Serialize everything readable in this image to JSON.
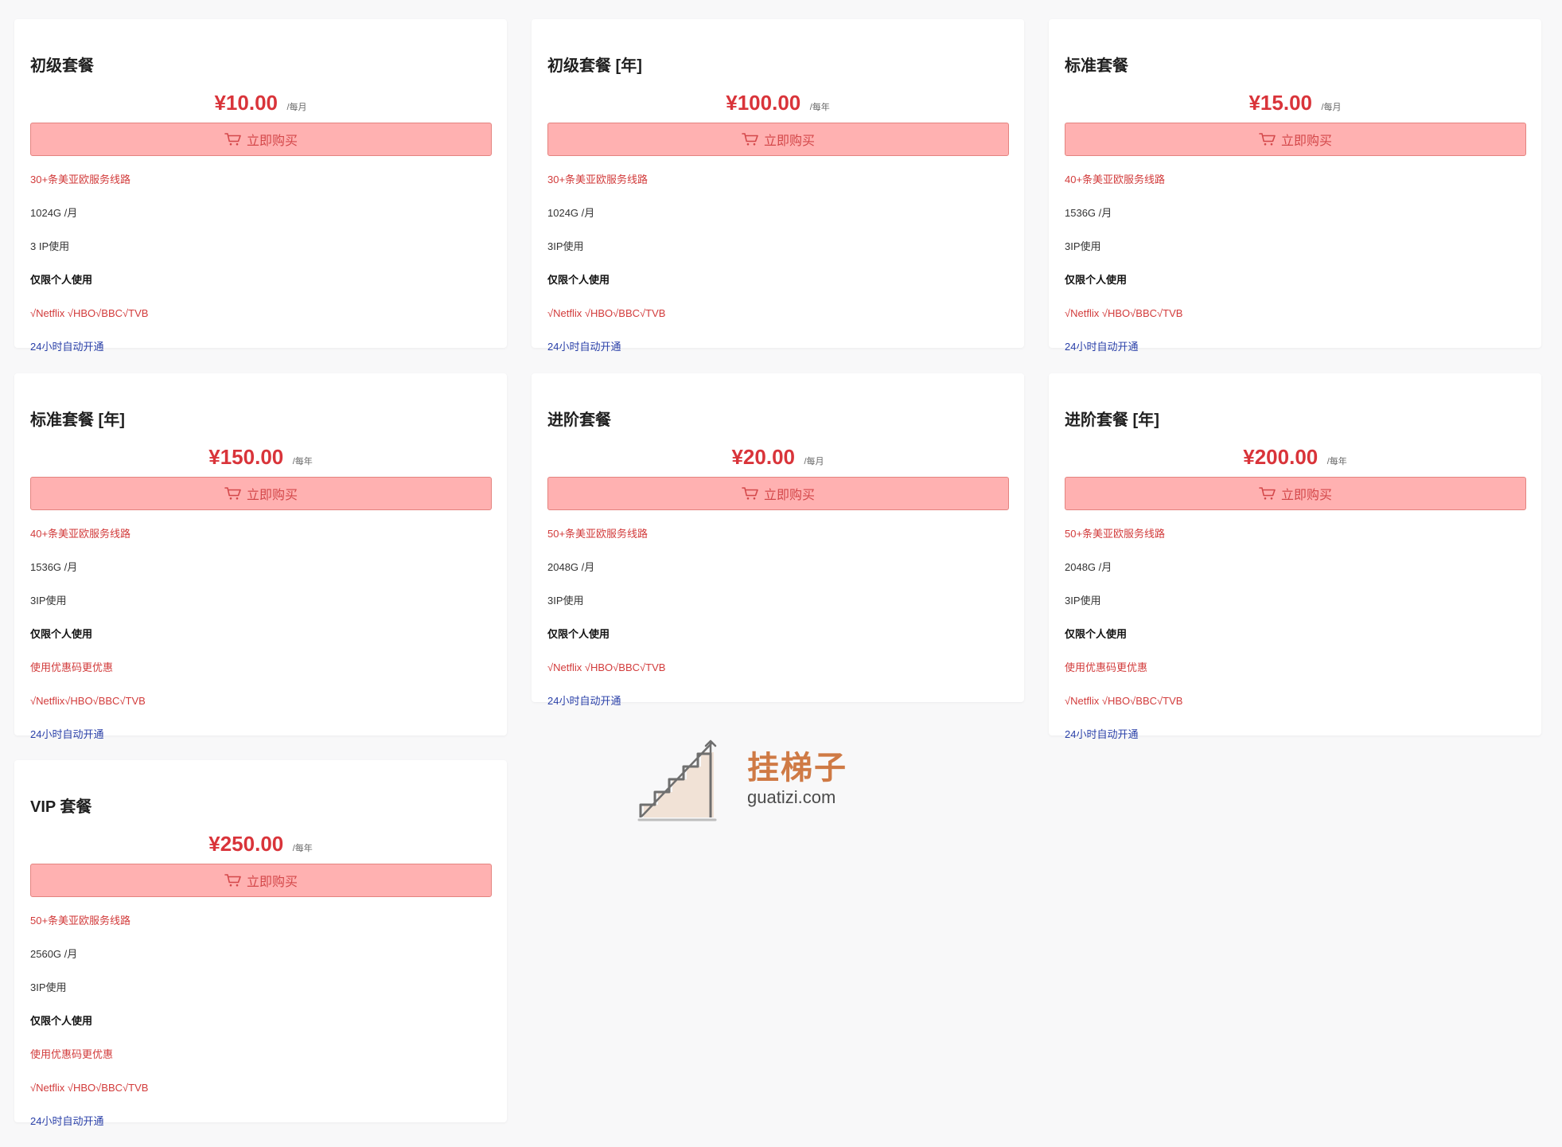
{
  "plans": [
    {
      "title": "初级套餐",
      "price": "¥10.00",
      "period": "/每月",
      "button_label": "立即购买",
      "features": [
        {
          "text": "30+条美亚欧服务线路",
          "style": "red"
        },
        {
          "text": "1024G /月",
          "style": "dark"
        },
        {
          "text": "3 IP使用",
          "style": "dark"
        },
        {
          "text": "仅限个人使用",
          "style": "bold"
        },
        {
          "text": "√Netflix √HBO√BBC√TVB",
          "style": "red"
        },
        {
          "text": "24小时自动开通",
          "style": "blue"
        }
      ]
    },
    {
      "title": "初级套餐 [年]",
      "price": "¥100.00",
      "period": "/每年",
      "button_label": "立即购买",
      "features": [
        {
          "text": "30+条美亚欧服务线路",
          "style": "red"
        },
        {
          "text": "1024G /月",
          "style": "dark"
        },
        {
          "text": "3IP使用",
          "style": "dark"
        },
        {
          "text": "仅限个人使用",
          "style": "bold"
        },
        {
          "text": "√Netflix √HBO√BBC√TVB",
          "style": "red"
        },
        {
          "text": "24小时自动开通",
          "style": "blue"
        }
      ]
    },
    {
      "title": "标准套餐",
      "price": "¥15.00",
      "period": "/每月",
      "button_label": "立即购买",
      "features": [
        {
          "text": "40+条美亚欧服务线路",
          "style": "red"
        },
        {
          "text": "1536G /月",
          "style": "dark"
        },
        {
          "text": "3IP使用",
          "style": "dark"
        },
        {
          "text": "仅限个人使用",
          "style": "bold"
        },
        {
          "text": "√Netflix √HBO√BBC√TVB",
          "style": "red"
        },
        {
          "text": "24小时自动开通",
          "style": "blue"
        }
      ]
    },
    {
      "title": "标准套餐 [年]",
      "price": "¥150.00",
      "period": "/每年",
      "button_label": "立即购买",
      "features": [
        {
          "text": "40+条美亚欧服务线路",
          "style": "red"
        },
        {
          "text": "1536G /月",
          "style": "dark"
        },
        {
          "text": "3IP使用",
          "style": "dark"
        },
        {
          "text": "仅限个人使用",
          "style": "bold"
        },
        {
          "text": "使用优惠码更优惠",
          "style": "red"
        },
        {
          "text": "√Netflix√HBO√BBC√TVB",
          "style": "red"
        },
        {
          "text": "24小时自动开通",
          "style": "blue"
        }
      ]
    },
    {
      "title": "进阶套餐",
      "price": "¥20.00",
      "period": "/每月",
      "button_label": "立即购买",
      "features": [
        {
          "text": "50+条美亚欧服务线路",
          "style": "red"
        },
        {
          "text": "2048G /月",
          "style": "dark"
        },
        {
          "text": "3IP使用",
          "style": "dark"
        },
        {
          "text": "仅限个人使用",
          "style": "bold"
        },
        {
          "text": "√Netflix √HBO√BBC√TVB",
          "style": "red"
        },
        {
          "text": "24小时自动开通",
          "style": "blue"
        }
      ]
    },
    {
      "title": "进阶套餐 [年]",
      "price": "¥200.00",
      "period": "/每年",
      "button_label": "立即购买",
      "features": [
        {
          "text": "50+条美亚欧服务线路",
          "style": "red"
        },
        {
          "text": "2048G /月",
          "style": "dark"
        },
        {
          "text": "3IP使用",
          "style": "dark"
        },
        {
          "text": "仅限个人使用",
          "style": "bold"
        },
        {
          "text": "使用优惠码更优惠",
          "style": "red"
        },
        {
          "text": "√Netflix √HBO√BBC√TVB",
          "style": "red"
        },
        {
          "text": "24小时自动开通",
          "style": "blue"
        }
      ]
    },
    {
      "title": "VIP 套餐",
      "price": "¥250.00",
      "period": "/每年",
      "button_label": "立即购买",
      "features": [
        {
          "text": "50+条美亚欧服务线路",
          "style": "red"
        },
        {
          "text": "2560G /月",
          "style": "dark"
        },
        {
          "text": "3IP使用",
          "style": "dark"
        },
        {
          "text": "仅限个人使用",
          "style": "bold"
        },
        {
          "text": "使用优惠码更优惠",
          "style": "red"
        },
        {
          "text": "√Netflix √HBO√BBC√TVB",
          "style": "red"
        },
        {
          "text": "24小时自动开通",
          "style": "blue"
        }
      ]
    }
  ],
  "watermark": {
    "name_cn": "挂梯子",
    "domain": "guatizi.com",
    "icon": "stairs-logo-icon"
  },
  "colors": {
    "price": "#d9343a",
    "button_bg": "#ffb1b1",
    "button_border": "#e4837f",
    "feature_red": "#d23b3b",
    "feature_blue": "#2a40a8",
    "page_bg": "#f8f8f9"
  },
  "icons": {
    "buy_button": "cart-icon"
  }
}
